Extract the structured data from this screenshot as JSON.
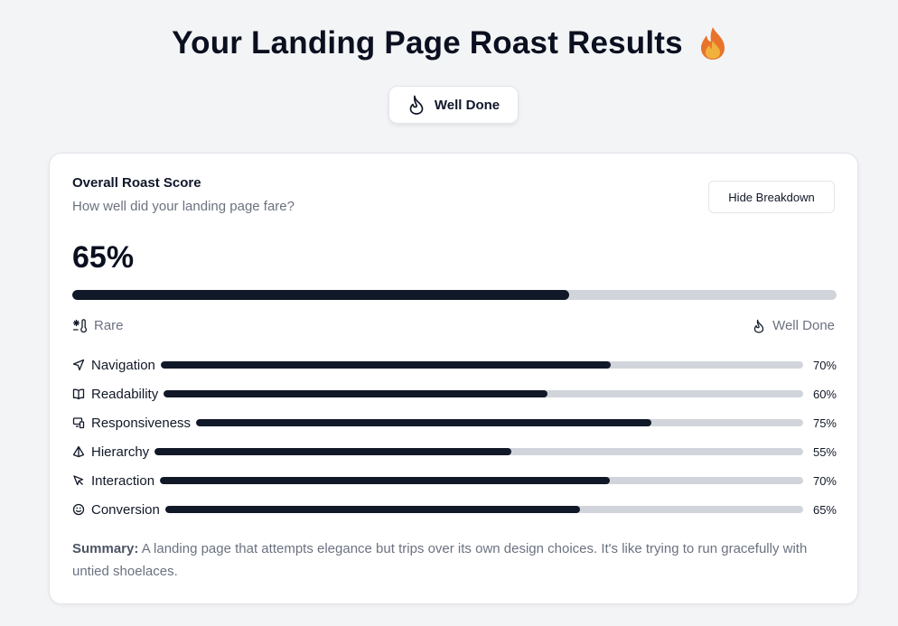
{
  "header": {
    "title": "Your Landing Page Roast Results",
    "emoji_icon": "fire-emoji"
  },
  "badge": {
    "label": "Well Done",
    "icon": "flame-icon"
  },
  "card": {
    "title": "Overall Roast Score",
    "subtitle": "How well did your landing page fare?",
    "toggle_label": "Hide Breakdown",
    "score_text": "65%",
    "score_value": 65,
    "scale_min_label": "Rare",
    "scale_min_icon": "thermometer-snowflake-icon",
    "scale_max_label": "Well Done",
    "scale_max_icon": "flame-icon"
  },
  "metrics": [
    {
      "label": "Navigation",
      "icon": "navigation-arrow-icon",
      "value": 70,
      "value_text": "70%"
    },
    {
      "label": "Readability",
      "icon": "book-open-icon",
      "value": 60,
      "value_text": "60%"
    },
    {
      "label": "Responsiveness",
      "icon": "devices-icon",
      "value": 75,
      "value_text": "75%"
    },
    {
      "label": "Hierarchy",
      "icon": "pyramid-icon",
      "value": 55,
      "value_text": "55%"
    },
    {
      "label": "Interaction",
      "icon": "mouse-pointer-icon",
      "value": 70,
      "value_text": "70%"
    },
    {
      "label": "Conversion",
      "icon": "smile-icon",
      "value": 65,
      "value_text": "65%"
    }
  ],
  "summary": {
    "label": "Summary:",
    "text": " A landing page that attempts elegance but trips over its own design choices. It's like trying to run gracefully with untied shoelaces."
  },
  "colors": {
    "background": "#f3f4f6",
    "bar_fill": "#111827",
    "bar_track": "#d1d5db",
    "flame_orange": "#e8742c",
    "flame_yellow": "#f2b13d"
  }
}
